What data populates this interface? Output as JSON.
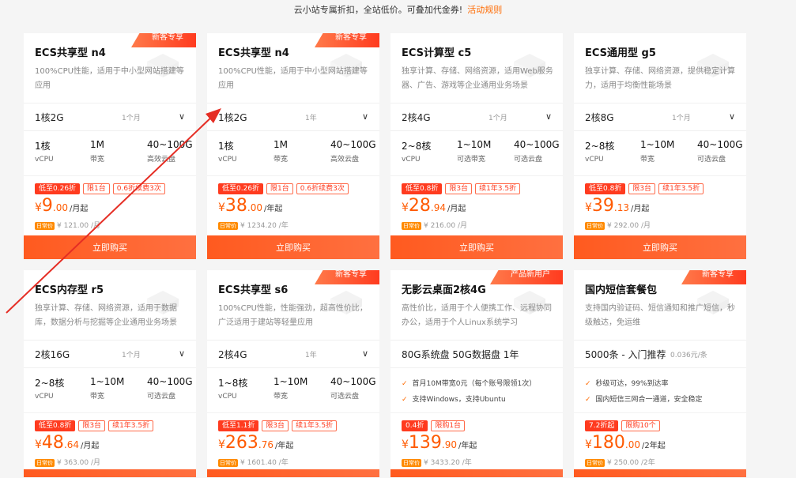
{
  "topbar": {
    "text": "云小站专属折扣，全站低价。可叠加代金券!",
    "link": "活动规则"
  },
  "cards": [
    {
      "badge": "新客专享",
      "title": "ECS共享型 n4",
      "desc": "100%CPU性能，适用于中小型网站搭建等应用",
      "select_value": "1核2G",
      "duration": "1个月",
      "specs": [
        {
          "v": "1核",
          "l": "vCPU"
        },
        {
          "v": "1M",
          "l": "带宽"
        },
        {
          "v": "40~100G",
          "l": "高效云盘"
        }
      ],
      "tags": [
        "低至0.26折",
        "限1台",
        "0.6折续费3次"
      ],
      "price_cur": "¥",
      "price_int": "9",
      "price_dec": ".00",
      "price_unit": "/月起",
      "orig_tag": "日常价",
      "orig": "¥ 121.00 /月",
      "buy": "立即购买"
    },
    {
      "badge": "新客专享",
      "title": "ECS共享型 n4",
      "desc": "100%CPU性能，适用于中小型网站搭建等应用",
      "select_value": "1核2G",
      "duration": "1年",
      "specs": [
        {
          "v": "1核",
          "l": "vCPU"
        },
        {
          "v": "1M",
          "l": "带宽"
        },
        {
          "v": "40~100G",
          "l": "高效云盘"
        }
      ],
      "tags": [
        "低至0.26折",
        "限1台",
        "0.6折续费3次"
      ],
      "price_cur": "¥",
      "price_int": "38",
      "price_dec": ".00",
      "price_unit": "/年起",
      "orig_tag": "日常价",
      "orig": "¥ 1234.20 /年",
      "buy": "立即购买"
    },
    {
      "badge": "",
      "title": "ECS计算型 c5",
      "desc": "独享计算、存储、网络资源，适用Web服务器、广告、游戏等企业通用业务场景",
      "select_value": "2核4G",
      "duration": "1个月",
      "specs": [
        {
          "v": "2~8核",
          "l": "vCPU"
        },
        {
          "v": "1~10M",
          "l": "可选带宽"
        },
        {
          "v": "40~100G",
          "l": "可选云盘"
        }
      ],
      "tags": [
        "低至0.8折",
        "限3台",
        "续1年3.5折"
      ],
      "price_cur": "¥",
      "price_int": "28",
      "price_dec": ".94",
      "price_unit": "/月起",
      "orig_tag": "日常价",
      "orig": "¥ 216.00 /月",
      "buy": "立即购买"
    },
    {
      "badge": "",
      "title": "ECS通用型 g5",
      "desc": "独享计算、存储、网络资源，提供稳定计算力，适用于均衡性能场景",
      "select_value": "2核8G",
      "duration": "1个月",
      "specs": [
        {
          "v": "2~8核",
          "l": "vCPU"
        },
        {
          "v": "1~10M",
          "l": "带宽"
        },
        {
          "v": "40~100G",
          "l": "可选云盘"
        }
      ],
      "tags": [
        "低至0.8折",
        "限3台",
        "续1年3.5折"
      ],
      "price_cur": "¥",
      "price_int": "39",
      "price_dec": ".13",
      "price_unit": "/月起",
      "orig_tag": "日常价",
      "orig": "¥ 292.00 /月",
      "buy": "立即购买"
    },
    {
      "badge": "",
      "title": "ECS内存型 r5",
      "desc": "独享计算、存储、网络资源，适用于数据库，数据分析与挖掘等企业通用业务场景",
      "select_value": "2核16G",
      "duration": "1个月",
      "specs": [
        {
          "v": "2~8核",
          "l": "vCPU"
        },
        {
          "v": "1~10M",
          "l": "带宽"
        },
        {
          "v": "40~100G",
          "l": "可选云盘"
        }
      ],
      "tags": [
        "低至0.8折",
        "限3台",
        "续1年3.5折"
      ],
      "price_cur": "¥",
      "price_int": "48",
      "price_dec": ".64",
      "price_unit": "/月起",
      "orig_tag": "日常价",
      "orig": "¥ 363.00 /月",
      "buy": ""
    },
    {
      "badge": "新客专享",
      "title": "ECS共享型 s6",
      "desc": "100%CPU性能，性能强劲，超高性价比，广泛适用于建站等轻量应用",
      "select_value": "2核4G",
      "duration": "1年",
      "specs": [
        {
          "v": "1~8核",
          "l": "vCPU"
        },
        {
          "v": "1~10M",
          "l": "带宽"
        },
        {
          "v": "40~100G",
          "l": "可选云盘"
        }
      ],
      "tags": [
        "低至1.1折",
        "限3台",
        "续1年3.5折"
      ],
      "price_cur": "¥",
      "price_int": "263",
      "price_dec": ".76",
      "price_unit": "/年起",
      "orig_tag": "日常价",
      "orig": "¥ 1601.40 /年",
      "buy": ""
    },
    {
      "badge": "产品新用户",
      "title": "无影云桌面2核4G",
      "desc": "高性价比，适用于个人便携工作、远程协同办公，适用于个人Linux系统学习",
      "select_value": "80G系统盘 50G数据盘 1年",
      "duration": "",
      "features": [
        "首月10M带宽0元（每个账号限领1次）",
        "支持Windows，支持Ubuntu"
      ],
      "tags": [
        "0.4折",
        "限购1台"
      ],
      "price_cur": "¥",
      "price_int": "139",
      "price_dec": ".90",
      "price_unit": "/年起",
      "orig_tag": "日常价",
      "orig": "¥ 3433.20 /年",
      "buy": ""
    },
    {
      "badge": "新客专享",
      "title": "国内短信套餐包",
      "desc": "支持国内验证码、短信通知和推广短信，秒级触达，免运维",
      "select_value": "5000条 - 入门推荐",
      "duration": "0.036元/条",
      "features": [
        "秒级可达，99%到达率",
        "国内短信三网合一通道，安全稳定"
      ],
      "tags": [
        "7.2折起",
        "限购10个"
      ],
      "price_cur": "¥",
      "price_int": "180",
      "price_dec": ".00",
      "price_unit": "/2年起",
      "orig_tag": "日常价",
      "orig": "¥ 250.00 /2年",
      "buy": ""
    }
  ]
}
